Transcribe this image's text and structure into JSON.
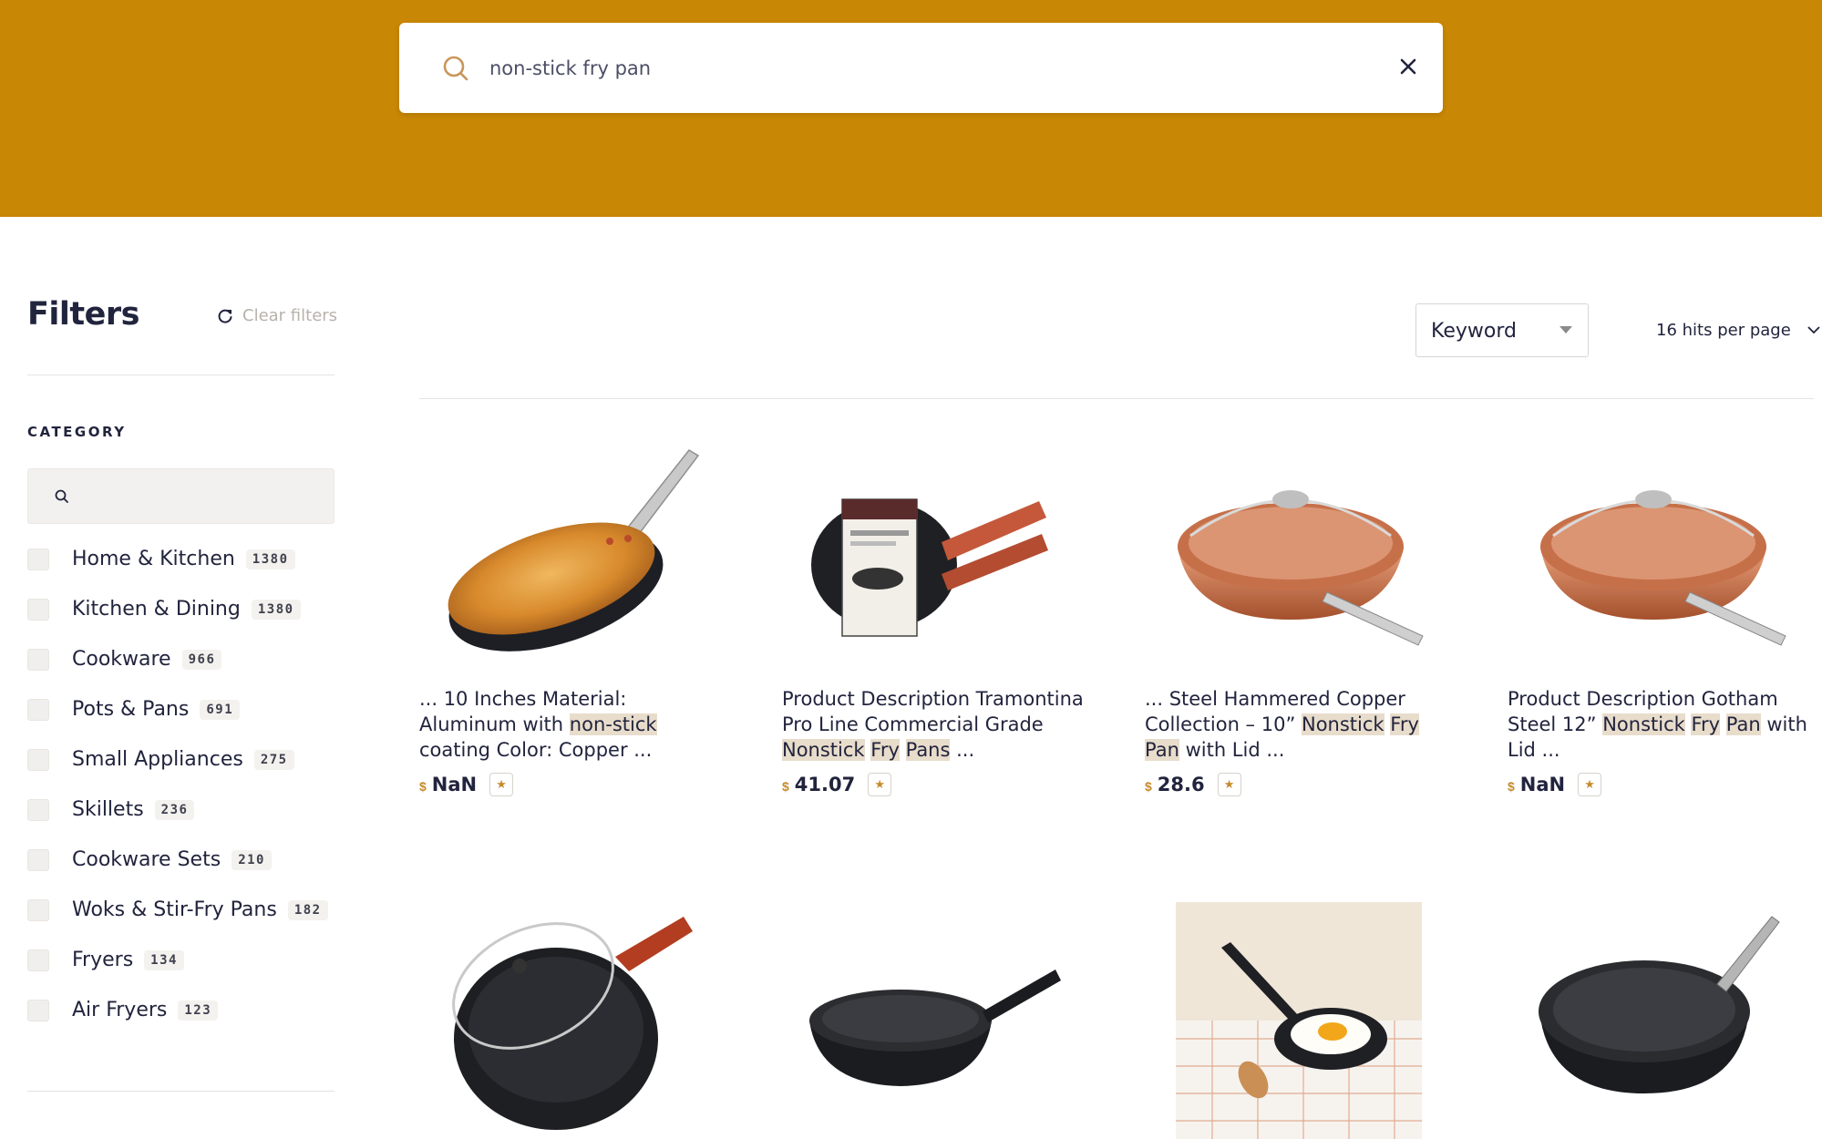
{
  "search": {
    "value": "non-stick fry pan",
    "placeholder": ""
  },
  "sidebar": {
    "title": "Filters",
    "clear_label": "Clear filters",
    "category_label": "CATEGORY",
    "categories": [
      {
        "name": "Home & Kitchen",
        "count": "1380"
      },
      {
        "name": "Kitchen & Dining",
        "count": "1380"
      },
      {
        "name": "Cookware",
        "count": "966"
      },
      {
        "name": "Pots & Pans",
        "count": "691"
      },
      {
        "name": "Small Appliances",
        "count": "275"
      },
      {
        "name": "Skillets",
        "count": "236"
      },
      {
        "name": "Cookware Sets",
        "count": "210"
      },
      {
        "name": "Woks & Stir-Fry Pans",
        "count": "182"
      },
      {
        "name": "Fryers",
        "count": "134"
      },
      {
        "name": "Air Fryers",
        "count": "123"
      }
    ]
  },
  "toolbar": {
    "sort_value": "Keyword",
    "hits_per_page": "16 hits per page"
  },
  "products": [
    {
      "parts": [
        [
          "... 10 Inches Material: Aluminum with ",
          false
        ],
        [
          "non-stick",
          true
        ],
        [
          " coating Color: Copper ...",
          false
        ]
      ],
      "currency": "$",
      "price": "NaN",
      "rating_icon": "star-icon"
    },
    {
      "parts": [
        [
          "Product Description Tramontina Pro Line Commercial Grade ",
          false
        ],
        [
          "Nonstick",
          true
        ],
        [
          " ",
          false
        ],
        [
          "Fry",
          true
        ],
        [
          " ",
          false
        ],
        [
          "Pans",
          true
        ],
        [
          " ...",
          false
        ]
      ],
      "currency": "$",
      "price": "41.07",
      "rating_icon": "star-icon"
    },
    {
      "parts": [
        [
          "... Steel Hammered Copper Collection – 10” ",
          false
        ],
        [
          "Nonstick",
          true
        ],
        [
          " ",
          false
        ],
        [
          "Fry",
          true
        ],
        [
          " ",
          false
        ],
        [
          "Pan",
          true
        ],
        [
          " with Lid ...",
          false
        ]
      ],
      "currency": "$",
      "price": "28.6",
      "rating_icon": "star-icon"
    },
    {
      "parts": [
        [
          "Product Description Gotham Steel 12” ",
          false
        ],
        [
          "Nonstick",
          true
        ],
        [
          " ",
          false
        ],
        [
          "Fry",
          true
        ],
        [
          " ",
          false
        ],
        [
          "Pan",
          true
        ],
        [
          " with Lid ...",
          false
        ]
      ],
      "currency": "$",
      "price": "NaN",
      "rating_icon": "star-icon"
    }
  ],
  "colors": {
    "header": "#c88704",
    "accent": "#c58b2c",
    "highlight": "#e8dccb"
  }
}
